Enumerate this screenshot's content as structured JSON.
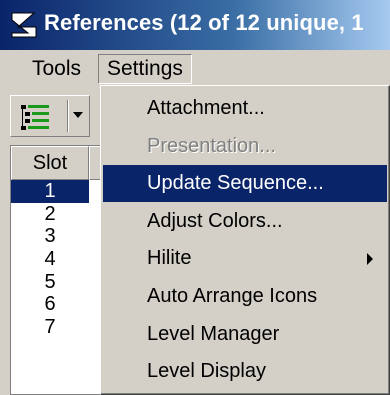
{
  "window": {
    "title": "References (12 of 12 unique, 1"
  },
  "menubar": {
    "tools": "Tools",
    "settings": "Settings"
  },
  "list": {
    "column_header": "Slot",
    "rows": [
      "1",
      "2",
      "3",
      "4",
      "5",
      "6",
      "7"
    ],
    "selected_index": 0
  },
  "settings_menu": {
    "items": [
      {
        "label": "Attachment...",
        "state": "normal"
      },
      {
        "label": "Presentation...",
        "state": "disabled"
      },
      {
        "label": "Update Sequence...",
        "state": "highlighted"
      },
      {
        "label": "Adjust Colors...",
        "state": "normal"
      },
      {
        "label": "Hilite",
        "state": "normal",
        "has_submenu": true
      },
      {
        "label": "Auto Arrange Icons",
        "state": "normal"
      },
      {
        "label": "Level Manager",
        "state": "normal"
      },
      {
        "label": "Level Display",
        "state": "normal"
      }
    ]
  },
  "colors": {
    "selection": "#0a246a",
    "face": "#d4d0c8",
    "disabled_text": "#808080"
  },
  "icons": {
    "app": "microstation-logo-icon",
    "toolbar": "list-tree-icon",
    "dropdown": "chevron-down-icon",
    "submenu": "submenu-arrow-icon"
  }
}
